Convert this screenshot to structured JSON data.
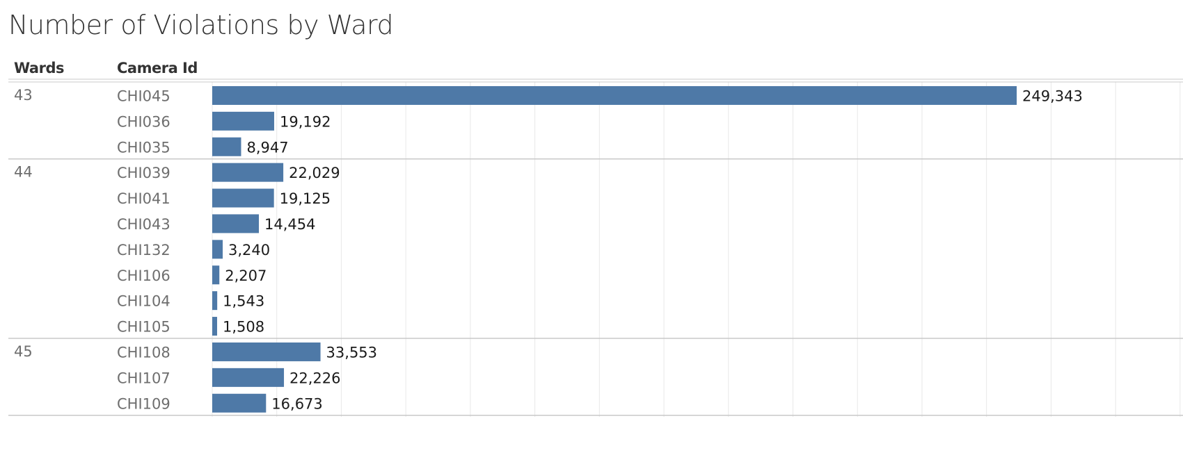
{
  "title": "Number of Violations by Ward",
  "headers": {
    "wards": "Wards",
    "camera_id": "Camera Id"
  },
  "colors": {
    "bar": "#4e79a7",
    "grid": "#e8e8e8",
    "divider": "#c8c8c8",
    "text": "#6e6e6e"
  },
  "chart_data": {
    "type": "bar",
    "orientation": "horizontal",
    "title": "Number of Violations by Ward",
    "xlim": [
      0,
      270000
    ],
    "grid": true,
    "value_labels": true,
    "groups": [
      {
        "ward": "43",
        "rows": [
          {
            "camera": "CHI045",
            "value": 249343,
            "label": "249,343"
          },
          {
            "camera": "CHI036",
            "value": 19192,
            "label": "19,192"
          },
          {
            "camera": "CHI035",
            "value": 8947,
            "label": "8,947"
          }
        ]
      },
      {
        "ward": "44",
        "rows": [
          {
            "camera": "CHI039",
            "value": 22029,
            "label": "22,029"
          },
          {
            "camera": "CHI041",
            "value": 19125,
            "label": "19,125"
          },
          {
            "camera": "CHI043",
            "value": 14454,
            "label": "14,454"
          },
          {
            "camera": "CHI132",
            "value": 3240,
            "label": "3,240"
          },
          {
            "camera": "CHI106",
            "value": 2207,
            "label": "2,207"
          },
          {
            "camera": "CHI104",
            "value": 1543,
            "label": "1,543"
          },
          {
            "camera": "CHI105",
            "value": 1508,
            "label": "1,508"
          }
        ]
      },
      {
        "ward": "45",
        "rows": [
          {
            "camera": "CHI108",
            "value": 33553,
            "label": "33,553"
          },
          {
            "camera": "CHI107",
            "value": 22226,
            "label": "22,226"
          },
          {
            "camera": "CHI109",
            "value": 16673,
            "label": "16,673"
          }
        ]
      }
    ]
  }
}
